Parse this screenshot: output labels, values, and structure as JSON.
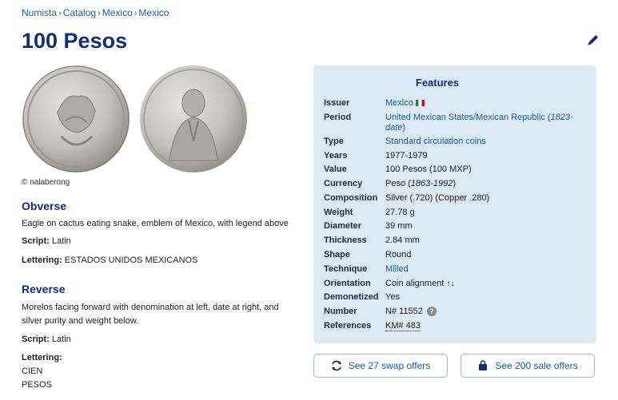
{
  "breadcrumb": [
    "Numista",
    "Catalog",
    "Mexico",
    "Mexico"
  ],
  "breadcrumb_sep": "›",
  "title": "100 Pesos",
  "credit": "© nalaberong",
  "obverse": {
    "heading": "Obverse",
    "description": "Eagle on cactus eating snake, emblem of Mexico, with legend above",
    "script_label": "Script:",
    "script_value": "Latin",
    "lettering_label": "Lettering:",
    "lettering_value": "ESTADOS UNIDOS MEXICANOS"
  },
  "reverse": {
    "heading": "Reverse",
    "description": "Morelos facing forward with denomination at left, date at right, and silver purity and weight below.",
    "script_label": "Script:",
    "script_value": "Latin",
    "lettering_label": "Lettering:",
    "lettering_lines": [
      "CIEN",
      "PESOS"
    ]
  },
  "features": {
    "heading": "Features",
    "issuer_label": "Issuer",
    "issuer_value": "Mexico",
    "period_label": "Period",
    "period_value": "United Mexican States/Mexican Republic (",
    "period_dates": "1823-date",
    "period_close": ")",
    "type_label": "Type",
    "type_value": "Standard circulation coins",
    "years_label": "Years",
    "years_value": "1977-1979",
    "value_label": "Value",
    "value_value": "100 Pesos (100 MXP)",
    "currency_label": "Currency",
    "currency_value": "Peso (",
    "currency_dates": "1863-1992",
    "currency_close": ")",
    "composition_label": "Composition",
    "composition_value": "Silver (.720) (Copper .280)",
    "weight_label": "Weight",
    "weight_value": "27.78 g",
    "diameter_label": "Diameter",
    "diameter_value": "39 mm",
    "thickness_label": "Thickness",
    "thickness_value": "2.84 mm",
    "shape_label": "Shape",
    "shape_value": "Round",
    "technique_label": "Technique",
    "technique_value": "Milled",
    "orientation_label": "Orientation",
    "orientation_value": "Coin alignment",
    "orientation_arrows": "↑↓",
    "demonetized_label": "Demonetized",
    "demonetized_value": "Yes",
    "number_label": "Number",
    "number_value": "N# 11552",
    "help_glyph": "?",
    "references_label": "References",
    "references_value": "KM# 483"
  },
  "offers": {
    "swap_label": "See 27 swap offers",
    "sale_label": "See 200 sale offers"
  },
  "colors": {
    "accent": "#1a5fa6",
    "title": "#0f2d78",
    "panel": "#dceaf6"
  }
}
